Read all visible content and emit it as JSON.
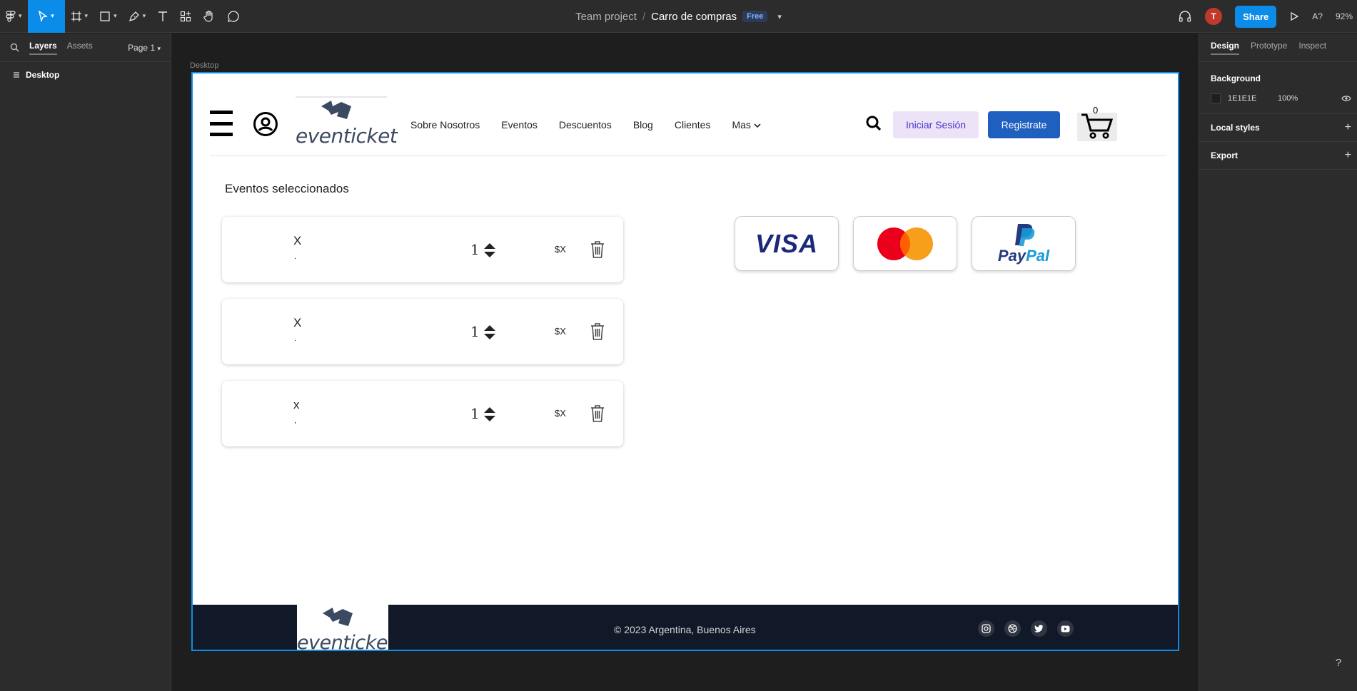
{
  "toolbar": {
    "team": "Team project",
    "separator": "/",
    "file_name": "Carro de compras",
    "plan_badge": "Free",
    "avatar_initial": "T",
    "share_label": "Share",
    "font_icon_label": "A?",
    "zoom": "92%"
  },
  "left_panel": {
    "tabs": [
      "Layers",
      "Assets"
    ],
    "page": "Page 1",
    "layers": [
      "Desktop"
    ]
  },
  "right_panel": {
    "tabs": [
      "Design",
      "Prototype",
      "Inspect"
    ],
    "background_label": "Background",
    "background_hex": "1E1E1E",
    "background_opacity": "100%",
    "local_styles": "Local styles",
    "export": "Export"
  },
  "canvas": {
    "frame_label": "Desktop",
    "nav": {
      "logo": "eventicket",
      "links": [
        "Sobre Nosotros",
        "Eventos",
        "Descuentos",
        "Blog",
        "Clientes",
        "Mas"
      ],
      "login": "Iniciar Sesión",
      "register": "Registrate",
      "cart_count": "0"
    },
    "section_title": "Eventos seleccionados",
    "items": [
      {
        "name": "X",
        "sub": ".",
        "qty": "1",
        "price": "$X"
      },
      {
        "name": "X",
        "sub": ".",
        "qty": "1",
        "price": "$X"
      },
      {
        "name": "x",
        "sub": ",",
        "qty": "1",
        "price": "$X"
      }
    ],
    "payments": {
      "visa": "VISA",
      "paypal_a": "Pay",
      "paypal_b": "Pal"
    },
    "footer": {
      "logo": "eventicket",
      "copyright": "© 2023 Argentina, Buenos Aires"
    }
  },
  "help": "?",
  "colors": {
    "accent": "#0c8ce9",
    "register_button": "#1f5fbf",
    "login_button": "#ede3f7",
    "footer": "#111827"
  },
  "icons": [
    "figma-menu-icon",
    "move-icon",
    "frame-icon",
    "rectangle-icon",
    "pen-icon",
    "text-icon",
    "components-icon",
    "hand-icon",
    "comment-icon",
    "headphones-icon",
    "play-icon",
    "search-icon",
    "user-icon",
    "cart-icon",
    "trash-icon",
    "stepper-icon",
    "instagram-icon",
    "dribbble-icon",
    "twitter-icon",
    "youtube-icon"
  ]
}
